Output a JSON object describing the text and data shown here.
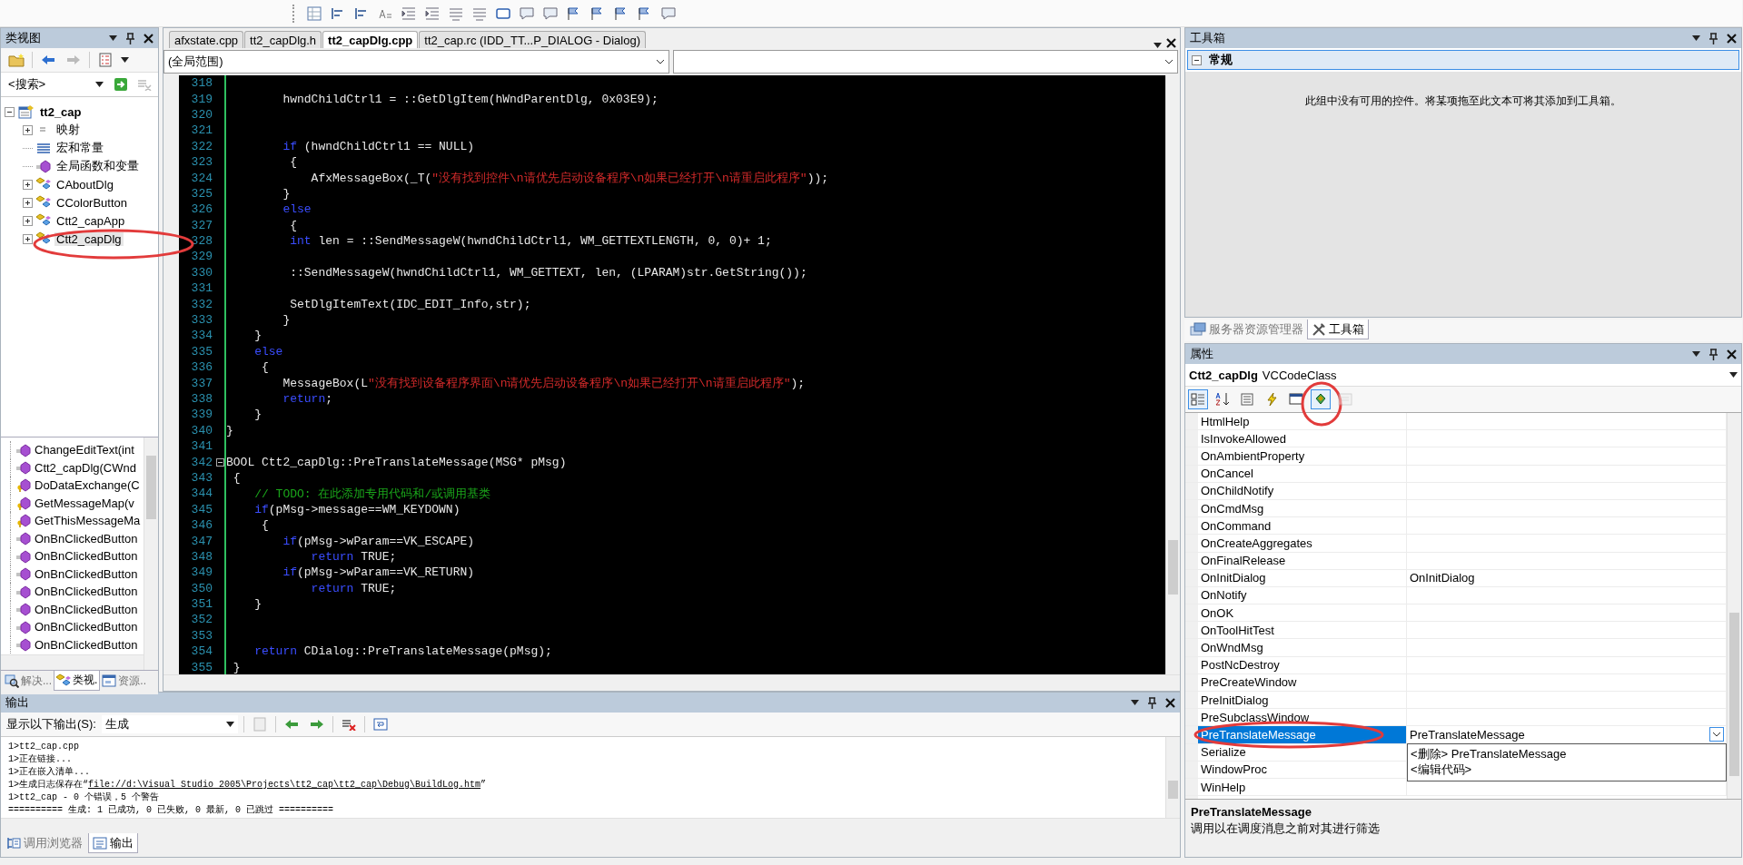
{
  "toolbar": {
    "buttons": [
      {
        "kind": "grid"
      },
      {
        "kind": "align"
      },
      {
        "kind": "align"
      },
      {
        "kind": "text"
      },
      {
        "kind": "indent"
      },
      {
        "kind": "indent"
      },
      {
        "kind": "list"
      },
      {
        "kind": "list"
      },
      {
        "kind": "rectangle"
      },
      {
        "kind": "bubble"
      },
      {
        "kind": "bubble"
      },
      {
        "kind": "flag"
      },
      {
        "kind": "flag"
      },
      {
        "kind": "flag"
      },
      {
        "kind": "flag"
      },
      {
        "kind": "bubble"
      }
    ]
  },
  "class_view": {
    "title": "类视图",
    "search": {
      "value": "<搜索>"
    },
    "tree": [
      {
        "label": "tt2_cap",
        "kind": "project",
        "expanded": true,
        "selected": false,
        "circled": false,
        "children": [
          {
            "label": "映射",
            "kind": "map",
            "expanded": false,
            "selected": false,
            "circled": false
          },
          {
            "label": "宏和常量",
            "kind": "macro",
            "selected": false,
            "circled": false
          },
          {
            "label": "全局函数和变量",
            "kind": "global",
            "selected": false,
            "circled": false
          },
          {
            "label": "CAboutDlg",
            "kind": "class",
            "expanded": false,
            "selected": false,
            "circled": false
          },
          {
            "label": "CColorButton",
            "kind": "class",
            "expanded": false,
            "selected": false,
            "circled": false
          },
          {
            "label": "Ctt2_capApp",
            "kind": "class",
            "expanded": false,
            "selected": false,
            "circled": false
          },
          {
            "label": "Ctt2_capDlg",
            "kind": "class",
            "expanded": false,
            "selected": true,
            "circled": true
          }
        ]
      }
    ],
    "members": [
      {
        "label": "ChangeEditText(int",
        "kind": "method"
      },
      {
        "label": "Ctt2_capDlg(CWnd",
        "kind": "method"
      },
      {
        "label": "DoDataExchange(C",
        "kind": "protected"
      },
      {
        "label": "GetMessageMap(v",
        "kind": "protected"
      },
      {
        "label": "GetThisMessageMa",
        "kind": "protected"
      },
      {
        "label": "OnBnClickedButton",
        "kind": "method"
      },
      {
        "label": "OnBnClickedButton",
        "kind": "method"
      },
      {
        "label": "OnBnClickedButton",
        "kind": "method"
      },
      {
        "label": "OnBnClickedButton",
        "kind": "method"
      },
      {
        "label": "OnBnClickedButton",
        "kind": "method"
      },
      {
        "label": "OnBnClickedButton",
        "kind": "method"
      },
      {
        "label": "OnBnClickedButton",
        "kind": "method"
      }
    ],
    "tabs": [
      {
        "label": "解决...",
        "kind": "solution",
        "selected": false
      },
      {
        "label": "类视.",
        "kind": "class",
        "selected": true
      },
      {
        "label": "资源..",
        "kind": "resource",
        "selected": false
      }
    ]
  },
  "editor": {
    "tabs": [
      {
        "label": "afxstate.cpp",
        "selected": false
      },
      {
        "label": "tt2_capDlg.h",
        "selected": false
      },
      {
        "label": "tt2_capDlg.cpp",
        "selected": true
      },
      {
        "label": "tt2_cap.rc (IDD_TT...P_DIALOG - Dialog)",
        "selected": false
      }
    ],
    "scope": "(全局范围)",
    "lines": [
      {
        "number": "318"
      },
      {
        "number": "319",
        "segments": [
          {
            "kind": "plain",
            "text": "        hwndChildCtrl1 = ::GetDlgItem(hWndParentDlg, 0x03E9);"
          }
        ]
      },
      {
        "number": "320"
      },
      {
        "number": "321"
      },
      {
        "number": "322",
        "segments": [
          {
            "kind": "keyword",
            "text": "        if"
          },
          {
            "kind": "plain",
            "text": " (hwndChildCtrl1 == NULL)"
          }
        ]
      },
      {
        "number": "323",
        "segments": [
          {
            "kind": "plain",
            "text": "         {"
          }
        ]
      },
      {
        "number": "324",
        "segments": [
          {
            "kind": "plain",
            "text": "            AfxMessageBox(_T("
          },
          {
            "kind": "string",
            "text": "\"没有找到控件\\n请优先启动设备程序\\n如果已经打开\\n请重启此程序\""
          },
          {
            "kind": "plain",
            "text": "));"
          }
        ]
      },
      {
        "number": "325",
        "segments": [
          {
            "kind": "plain",
            "text": "        }"
          }
        ]
      },
      {
        "number": "326",
        "segments": [
          {
            "kind": "keyword",
            "text": "        else"
          }
        ]
      },
      {
        "number": "327",
        "segments": [
          {
            "kind": "plain",
            "text": "         {"
          }
        ]
      },
      {
        "number": "328",
        "segments": [
          {
            "kind": "keyword",
            "text": "         int"
          },
          {
            "kind": "plain",
            "text": " len = ::SendMessageW(hwndChildCtrl1, WM_GETTEXTLENGTH, 0, 0)+ 1;"
          }
        ]
      },
      {
        "number": "329"
      },
      {
        "number": "330",
        "segments": [
          {
            "kind": "plain",
            "text": "         ::SendMessageW(hwndChildCtrl1, WM_GETTEXT, len, (LPARAM)str.GetString());"
          }
        ]
      },
      {
        "number": "331"
      },
      {
        "number": "332",
        "segments": [
          {
            "kind": "plain",
            "text": "         SetDlgItemText(IDC_EDIT_Info,str);"
          }
        ]
      },
      {
        "number": "333",
        "segments": [
          {
            "kind": "plain",
            "text": "        }"
          }
        ]
      },
      {
        "number": "334",
        "segments": [
          {
            "kind": "plain",
            "text": "    }"
          }
        ]
      },
      {
        "number": "335",
        "segments": [
          {
            "kind": "keyword",
            "text": "    else"
          }
        ]
      },
      {
        "number": "336",
        "segments": [
          {
            "kind": "plain",
            "text": "     {"
          }
        ]
      },
      {
        "number": "337",
        "segments": [
          {
            "kind": "plain",
            "text": "        MessageBox(L"
          },
          {
            "kind": "string",
            "text": "\"没有找到设备程序界面\\n请优先启动设备程序\\n如果已经打开\\n请重启此程序\""
          },
          {
            "kind": "plain",
            "text": ");"
          }
        ]
      },
      {
        "number": "338",
        "segments": [
          {
            "kind": "keyword",
            "text": "        return"
          },
          {
            "kind": "plain",
            "text": ";"
          }
        ]
      },
      {
        "number": "339",
        "segments": [
          {
            "kind": "plain",
            "text": "    }"
          }
        ]
      },
      {
        "number": "340",
        "segments": [
          {
            "kind": "plain",
            "text": "}"
          }
        ]
      },
      {
        "number": "341"
      },
      {
        "number": "342",
        "expanded": true,
        "segments": [
          {
            "kind": "plain",
            "text": "BOOL Ctt2_capDlg::PreTranslateMessage(MSG* pMsg)"
          }
        ]
      },
      {
        "number": "343",
        "segments": [
          {
            "kind": "plain",
            "text": " {"
          }
        ]
      },
      {
        "number": "344",
        "segments": [
          {
            "kind": "comment",
            "text": "    // TODO: 在此添加专用代码和/或调用基类"
          }
        ]
      },
      {
        "number": "345",
        "segments": [
          {
            "kind": "keyword",
            "text": "    if"
          },
          {
            "kind": "plain",
            "text": "(pMsg->message==WM_KEYDOWN)"
          }
        ]
      },
      {
        "number": "346",
        "segments": [
          {
            "kind": "plain",
            "text": "     {"
          }
        ]
      },
      {
        "number": "347",
        "segments": [
          {
            "kind": "keyword",
            "text": "        if"
          },
          {
            "kind": "plain",
            "text": "(pMsg->wParam==VK_ESCAPE)"
          }
        ]
      },
      {
        "number": "348",
        "segments": [
          {
            "kind": "keyword",
            "text": "            return"
          },
          {
            "kind": "plain",
            "text": " TRUE;"
          }
        ]
      },
      {
        "number": "349",
        "segments": [
          {
            "kind": "keyword",
            "text": "        if"
          },
          {
            "kind": "plain",
            "text": "(pMsg->wParam==VK_RETURN)"
          }
        ]
      },
      {
        "number": "350",
        "segments": [
          {
            "kind": "keyword",
            "text": "            return"
          },
          {
            "kind": "plain",
            "text": " TRUE;"
          }
        ]
      },
      {
        "number": "351",
        "segments": [
          {
            "kind": "plain",
            "text": "    }"
          }
        ]
      },
      {
        "number": "352"
      },
      {
        "number": "353"
      },
      {
        "number": "354",
        "segments": [
          {
            "kind": "keyword",
            "text": "    return"
          },
          {
            "kind": "plain",
            "text": " CDialog::PreTranslateMessage(pMsg);"
          }
        ]
      },
      {
        "number": "355",
        "segments": [
          {
            "kind": "plain",
            "text": " }"
          }
        ]
      }
    ]
  },
  "output": {
    "title": "输出",
    "show_label": "显示以下输出(S):",
    "source": "生成",
    "lines": [
      {
        "text": "1>tt2_cap.cpp"
      },
      {
        "text": "1>正在链接..."
      },
      {
        "text": "1>正在嵌入清单..."
      },
      {
        "text": "1>生成日志保存在“",
        "link": "file://d:\\Visual Studio 2005\\Projects\\tt2_cap\\tt2_cap\\Debug\\BuildLog.htm",
        "suffix": "”"
      },
      {
        "text": "1>tt2_cap - 0 个错误，5 个警告"
      },
      {
        "text": "========== 生成: 1 已成功, 0 已失败, 0 最新, 0 已跳过 =========="
      }
    ],
    "tabs": [
      {
        "label": "调用浏览器",
        "kind": "call-browser",
        "selected": false
      },
      {
        "label": "输出",
        "kind": "output",
        "selected": true
      }
    ]
  },
  "toolbox": {
    "title": "工具箱",
    "group": {
      "label": "常规",
      "expanded": true
    },
    "message": "此组中没有可用的控件。将某项拖至此文本可将其添加到工具箱。",
    "tabs": [
      {
        "label": "服务器资源管理器",
        "kind": "server",
        "selected": false
      },
      {
        "label": "工具箱",
        "kind": "tools",
        "selected": true
      }
    ]
  },
  "properties": {
    "title": "属性",
    "object": {
      "name": "Ctt2_capDlg",
      "type": "VCCodeClass"
    },
    "toolbar": [
      {
        "kind": "categorized",
        "selected": true,
        "disabled": false,
        "circled": false
      },
      {
        "kind": "alphabetical",
        "selected": false,
        "disabled": false,
        "circled": false
      },
      {
        "kind": "properties",
        "selected": false,
        "disabled": false,
        "circled": false
      },
      {
        "kind": "events",
        "selected": false,
        "disabled": false,
        "circled": false
      },
      {
        "kind": "messages",
        "selected": false,
        "disabled": false,
        "circled": false
      },
      {
        "kind": "overrides",
        "selected": true,
        "disabled": false,
        "circled": true
      },
      {
        "kind": "pages",
        "selected": false,
        "disabled": true,
        "circled": false
      }
    ],
    "rows": [
      {
        "name": "HtmlHelp",
        "selected": false,
        "circled": false
      },
      {
        "name": "IsInvokeAllowed",
        "selected": false,
        "circled": false
      },
      {
        "name": "OnAmbientProperty",
        "selected": false,
        "circled": false
      },
      {
        "name": "OnCancel",
        "selected": false,
        "circled": false
      },
      {
        "name": "OnChildNotify",
        "selected": false,
        "circled": false
      },
      {
        "name": "OnCmdMsg",
        "selected": false,
        "circled": false
      },
      {
        "name": "OnCommand",
        "selected": false,
        "circled": false
      },
      {
        "name": "OnCreateAggregates",
        "selected": false,
        "circled": false
      },
      {
        "name": "OnFinalRelease",
        "selected": false,
        "circled": false
      },
      {
        "name": "OnInitDialog",
        "value": "OnInitDialog",
        "selected": false,
        "circled": false
      },
      {
        "name": "OnNotify",
        "selected": false,
        "circled": false
      },
      {
        "name": "OnOK",
        "selected": false,
        "circled": false
      },
      {
        "name": "OnToolHitTest",
        "selected": false,
        "circled": false
      },
      {
        "name": "OnWndMsg",
        "selected": false,
        "circled": false
      },
      {
        "name": "PostNcDestroy",
        "selected": false,
        "circled": false
      },
      {
        "name": "PreCreateWindow",
        "selected": false,
        "circled": false
      },
      {
        "name": "PreInitDialog",
        "selected": false,
        "circled": false
      },
      {
        "name": "PreSubclassWindow",
        "selected": false,
        "circled": false
      },
      {
        "name": "PreTranslateMessage",
        "value": "PreTranslateMessage",
        "selected": true,
        "circled": true,
        "dropdown": [
          "<删除> PreTranslateMessage",
          "<编辑代码>"
        ]
      },
      {
        "name": "Serialize",
        "selected": false,
        "circled": false
      },
      {
        "name": "WindowProc",
        "selected": false,
        "circled": false
      },
      {
        "name": "WinHelp",
        "selected": false,
        "circled": false
      }
    ],
    "description": {
      "title": "PreTranslateMessage",
      "text": "调用以在调度消息之前对其进行筛选"
    }
  }
}
